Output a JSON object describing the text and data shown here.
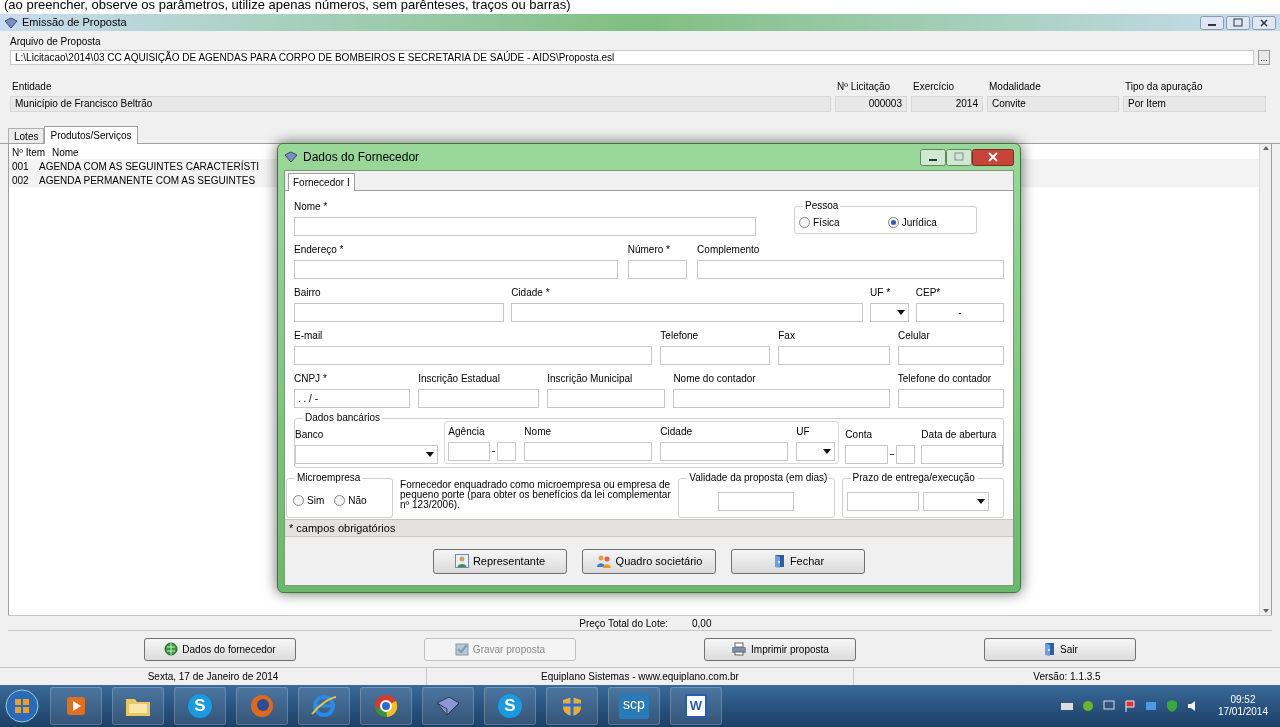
{
  "top_hint": "(ao preencher, observe os parâmetros, utilize apenas números, sem parênteses, traços ou barras)",
  "window": {
    "title": "Emissão de Proposta"
  },
  "arquivo": {
    "label": "Arquivo de Proposta",
    "value": "L:\\Licitacao\\2014\\03 CC AQUISIÇÃO DE AGENDAS PARA CORPO DE BOMBEIROS E SECRETARIA DE SAÚDE - AIDS\\Proposta.esl",
    "button": "..."
  },
  "info_fields": [
    {
      "label": "Entidade",
      "value": "Município de Francisco Beltrão"
    },
    {
      "label": "Nº Licitação",
      "value": "000003"
    },
    {
      "label": "Exercício",
      "value": "2014"
    },
    {
      "label": "Modalidade",
      "value": "Convite"
    },
    {
      "label": "Tipo da apuração",
      "value": "Por Item"
    }
  ],
  "tabs": [
    {
      "label": "Lotes",
      "selected": false
    },
    {
      "label": "Produtos/Serviços",
      "selected": true
    }
  ],
  "list": {
    "columns": [
      "Nº Item",
      "Nome"
    ],
    "rows": [
      [
        "001",
        "AGENDA COM AS SEGUINTES CARACTERÍSTI"
      ],
      [
        "002",
        "AGENDA PERMANENTE COM AS SEGUINTES"
      ]
    ]
  },
  "total": {
    "label": "Preço Total do Lote:",
    "value": "0,00"
  },
  "buttons": [
    {
      "label": "Dados do fornecedor",
      "disabled": false
    },
    {
      "label": "Gravar proposta",
      "disabled": true
    },
    {
      "label": "Imprimir proposta",
      "disabled": false
    },
    {
      "label": "Sair",
      "disabled": false
    }
  ],
  "status_bar": [
    "Sexta, 17 de Janeiro de 2014",
    "Equiplano Sistemas - www.equiplano.com.br",
    "Versão: 1.1.3.5"
  ],
  "dialog": {
    "title": "Dados do Fornecedor",
    "tabs": [
      {
        "label": "Fornecedor I",
        "selected": true
      }
    ],
    "name_field": {
      "label": "Nome *"
    },
    "pessoa": {
      "legend": "Pessoa",
      "options": [
        {
          "label": "Física",
          "selected": false
        },
        {
          "label": "Jurídica",
          "selected": true
        }
      ]
    },
    "rows": [
      [
        {
          "label": "Endereço *",
          "kind": "text"
        },
        {
          "label": "Número *",
          "kind": "text"
        },
        {
          "label": "Complemento",
          "kind": "text"
        }
      ],
      [
        {
          "label": "Bairro",
          "kind": "text"
        },
        {
          "label": "Cidade *",
          "kind": "text"
        },
        {
          "label": "UF *",
          "kind": "select"
        },
        {
          "label": "CEP*",
          "kind": "text",
          "value": "-"
        }
      ],
      [
        {
          "label": "E-mail",
          "kind": "text"
        },
        {
          "label": "Telefone",
          "kind": "text"
        },
        {
          "label": "Fax",
          "kind": "text"
        },
        {
          "label": "Celular",
          "kind": "text"
        }
      ],
      [
        {
          "label": "CNPJ *",
          "kind": "text",
          "value": ". . / -"
        },
        {
          "label": "Inscrição Estadual",
          "kind": "text"
        },
        {
          "label": "Inscrição Municipal",
          "kind": "text"
        },
        {
          "label": "Nome do contador",
          "kind": "text"
        },
        {
          "label": "Telefone do contador",
          "kind": "text"
        }
      ]
    ],
    "bank": {
      "legend": "Dados bancários",
      "banco": "Banco",
      "agencia": "Agência",
      "nome": "Nome",
      "cidade": "Cidade",
      "uf": "UF",
      "conta": "Conta",
      "data": "Data de abertura"
    },
    "micro": {
      "legend": "Microempresa",
      "options": [
        {
          "label": "Sim",
          "selected": false
        },
        {
          "label": "Não",
          "selected": false
        }
      ],
      "note": "Fornecedor enquadrado como microempresa ou empresa de pequeno porte (para obter os benefícios da lei complementar nº 123/2006)."
    },
    "validade": {
      "legend": "Validade da proposta (em dias)"
    },
    "prazo": {
      "legend": "Prazo de entrega/execução"
    },
    "required_note": "* campos obrigatórios",
    "buttons": [
      {
        "label": "Representante"
      },
      {
        "label": "Quadro societário"
      },
      {
        "label": "Fechar"
      }
    ]
  },
  "taskbar": {
    "apps": [
      {
        "kind": "media"
      },
      {
        "kind": "folder"
      },
      {
        "kind": "letter",
        "label": "S"
      },
      {
        "kind": "fox"
      },
      {
        "kind": "ie"
      },
      {
        "kind": "chrome"
      },
      {
        "kind": "book"
      },
      {
        "kind": "letter",
        "label": "S"
      },
      {
        "kind": "shield"
      },
      {
        "kind": "scp",
        "label": "scp"
      },
      {
        "kind": "doc",
        "label": "W"
      }
    ],
    "time": "09:52",
    "date": "17/01/2014"
  }
}
